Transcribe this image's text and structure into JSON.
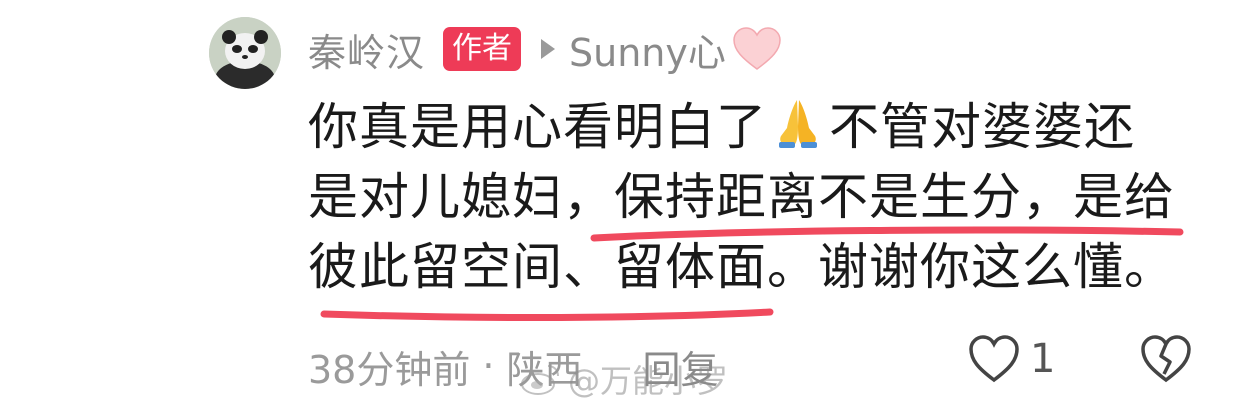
{
  "comment": {
    "username": "秦岭汉",
    "author_badge": "作者",
    "reply_to": "Sunny心",
    "text_line1_part1": "你真是用心看明白了",
    "text_line1_part2": "不管对婆婆还",
    "text_line2": "是对儿媳妇，保持距离不是生分，是给",
    "text_line3": "彼此留空间、留体面。谢谢你这么懂。",
    "time": "38分钟前",
    "separator": "·",
    "location": "陕西",
    "reply_label": "回复",
    "like_count": "1"
  },
  "watermark": {
    "text": "@万能小罗"
  },
  "colors": {
    "badge": "#ee3b57",
    "underline": "#f04a5e",
    "meta_text": "#9a9a9a"
  },
  "icons": [
    "avatar-panda",
    "play-arrow-icon",
    "pink-heart-emoji",
    "praying-hands-emoji",
    "heart-outline-icon",
    "broken-heart-icon",
    "weibo-logo-icon"
  ]
}
